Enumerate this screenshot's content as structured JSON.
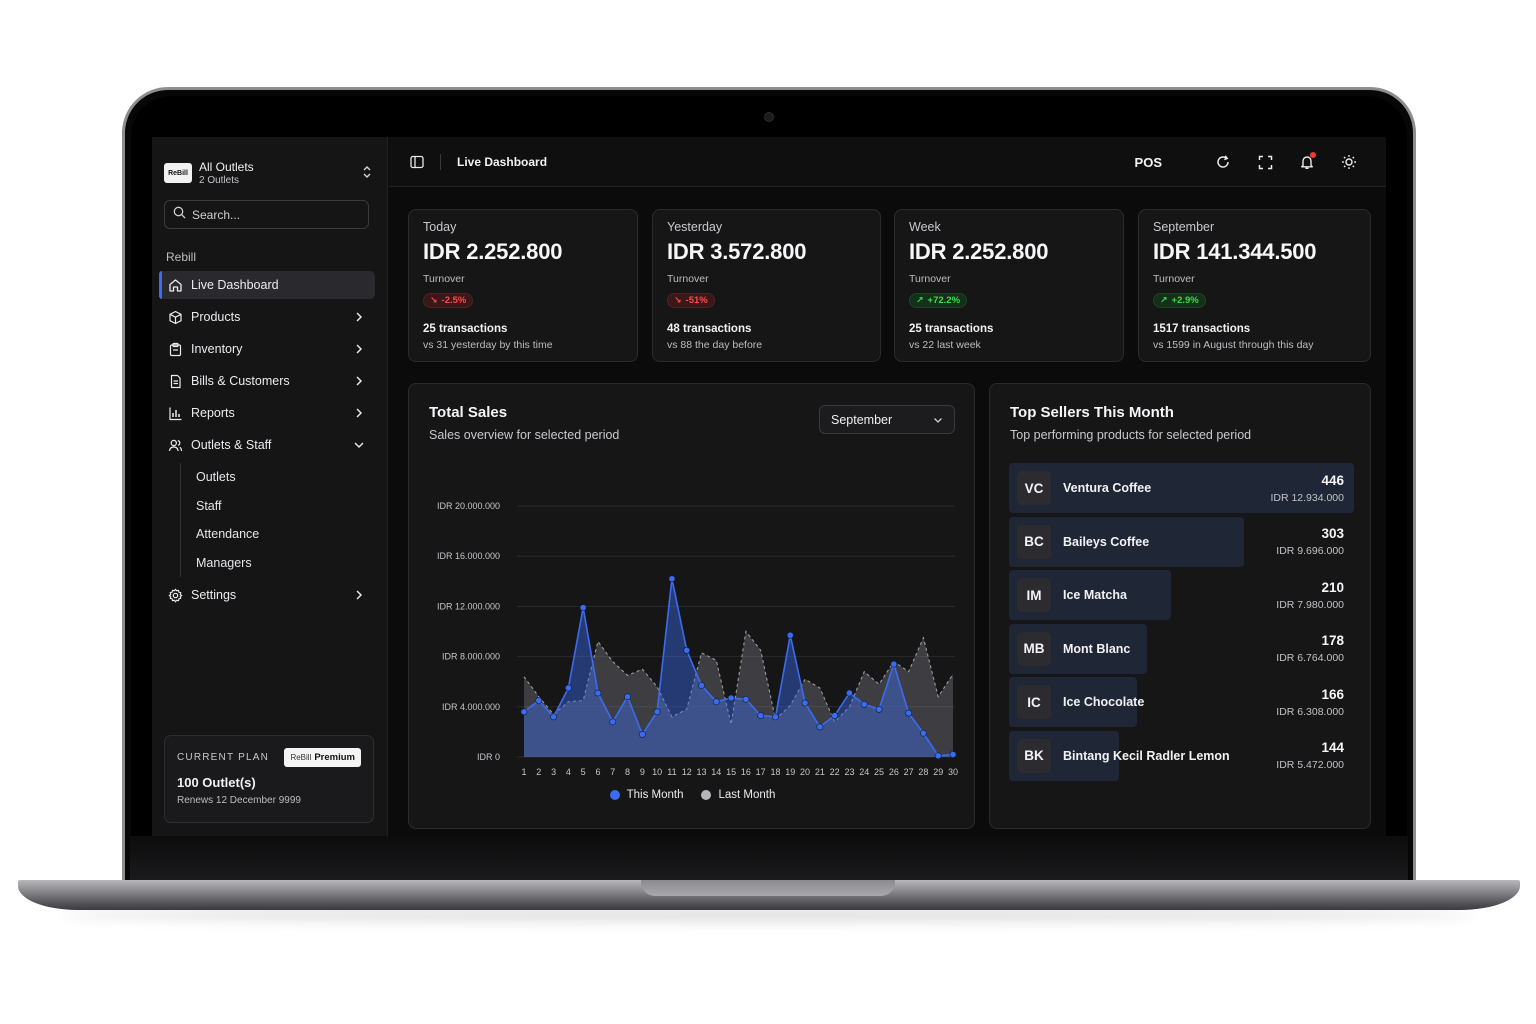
{
  "sidebar": {
    "logo_text": "ReBill",
    "outlet_name": "All Outlets",
    "outlet_count": "2 Outlets",
    "search_placeholder": "Search...",
    "group_label": "Rebill",
    "items": [
      {
        "label": "Live Dashboard",
        "icon": "home-icon",
        "active": true
      },
      {
        "label": "Products",
        "icon": "box-icon"
      },
      {
        "label": "Inventory",
        "icon": "inventory-icon"
      },
      {
        "label": "Bills & Customers",
        "icon": "receipt-icon"
      },
      {
        "label": "Reports",
        "icon": "bar-chart-icon"
      },
      {
        "label": "Outlets & Staff",
        "icon": "users-icon",
        "expanded": true
      },
      {
        "label": "Settings",
        "icon": "gear-icon"
      }
    ],
    "subitems": [
      "Outlets",
      "Staff",
      "Attendance",
      "Managers"
    ],
    "plan": {
      "label": "CURRENT PLAN",
      "badge_brand": "ReBill",
      "badge_tier": "Premium",
      "outlets": "100 Outlet(s)",
      "renews": "Renews 12 December 9999"
    }
  },
  "topbar": {
    "title": "Live Dashboard",
    "pos_label": "POS"
  },
  "stats": [
    {
      "period": "Today",
      "value": "IDR 2.252.800",
      "sub": "Turnover",
      "change": "-2.5%",
      "trend": "down",
      "transactions": "25 transactions",
      "compare": "vs 31 yesterday by this time"
    },
    {
      "period": "Yesterday",
      "value": "IDR 3.572.800",
      "sub": "Turnover",
      "change": "-51%",
      "trend": "down",
      "transactions": "48 transactions",
      "compare": "vs 88 the day before"
    },
    {
      "period": "Week",
      "value": "IDR 2.252.800",
      "sub": "Turnover",
      "change": "+72.2%",
      "trend": "up",
      "transactions": "25 transactions",
      "compare": "vs 22 last week"
    },
    {
      "period": "September",
      "value": "IDR 141.344.500",
      "sub": "Turnover",
      "change": "+2.9%",
      "trend": "up",
      "transactions": "1517 transactions",
      "compare": "vs 1599 in August through this day"
    }
  ],
  "sales": {
    "title": "Total Sales",
    "subtitle": "Sales overview for selected period",
    "period_select": "September",
    "legend_this": "This Month",
    "legend_last": "Last Month"
  },
  "colors": {
    "this_month": "#3b6cf0",
    "last_month": "#b5b5ba",
    "accent": "#3b6cf0",
    "down": "#ff4d4d",
    "up": "#3ddc4e"
  },
  "chart_data": {
    "type": "area",
    "x": [
      1,
      2,
      3,
      4,
      5,
      6,
      7,
      8,
      9,
      10,
      11,
      12,
      13,
      14,
      15,
      16,
      17,
      18,
      19,
      20,
      21,
      22,
      23,
      24,
      25,
      26,
      27,
      28,
      29,
      30
    ],
    "yticks": [
      "IDR 0",
      "IDR 4.000.000",
      "IDR 8.000.000",
      "IDR 12.000.000",
      "IDR 16.000.000",
      "IDR 20.000.000"
    ],
    "ylim": [
      0,
      20000000
    ],
    "grid": true,
    "legend": "bottom",
    "series": [
      {
        "name": "This Month",
        "values": [
          3600000,
          4500000,
          3200000,
          5500000,
          11900000,
          5100000,
          2800000,
          4800000,
          1800000,
          3600000,
          14200000,
          8500000,
          5700000,
          4400000,
          4700000,
          4600000,
          3300000,
          3200000,
          9700000,
          4300000,
          2400000,
          3300000,
          5100000,
          4200000,
          3800000,
          7400000,
          3500000,
          1900000,
          100000,
          200000
        ]
      },
      {
        "name": "Last Month",
        "values": [
          6400000,
          4800000,
          3400000,
          4400000,
          4500000,
          9200000,
          7600000,
          6500000,
          7000000,
          5600000,
          3200000,
          3800000,
          8300000,
          7700000,
          2600000,
          10000000,
          8500000,
          3000000,
          4100000,
          6200000,
          5500000,
          2800000,
          4000000,
          6800000,
          5800000,
          7600000,
          6800000,
          9500000,
          4800000,
          6600000
        ]
      }
    ]
  },
  "sellers": {
    "title": "Top Sellers This Month",
    "subtitle": "Top performing products for selected period",
    "items": [
      {
        "initials": "VC",
        "name": "Ventura Coffee",
        "qty": "446",
        "revenue": "IDR 12.934.000",
        "share": 1.0
      },
      {
        "initials": "BC",
        "name": "Baileys Coffee",
        "qty": "303",
        "revenue": "IDR 9.696.000",
        "share": 0.68
      },
      {
        "initials": "IM",
        "name": "Ice Matcha",
        "qty": "210",
        "revenue": "IDR 7.980.000",
        "share": 0.47
      },
      {
        "initials": "MB",
        "name": "Mont Blanc",
        "qty": "178",
        "revenue": "IDR 6.764.000",
        "share": 0.4
      },
      {
        "initials": "IC",
        "name": "Ice Chocolate",
        "qty": "166",
        "revenue": "IDR 6.308.000",
        "share": 0.37
      },
      {
        "initials": "BK",
        "name": "Bintang Kecil Radler Lemon",
        "qty": "144",
        "revenue": "IDR 5.472.000",
        "share": 0.32
      }
    ]
  }
}
